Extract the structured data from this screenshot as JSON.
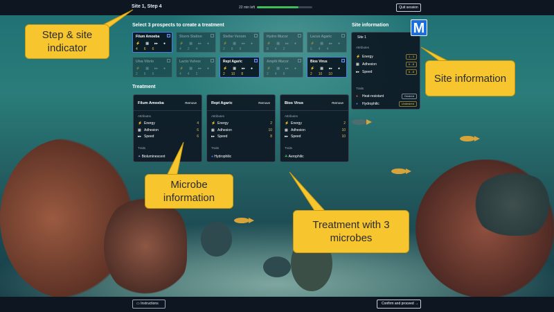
{
  "header": {
    "step": "Site 1, Step 4",
    "time_left": "22 min left",
    "progress": 0.75,
    "quit_label": "Quit session"
  },
  "prospects": {
    "heading": "Select 3 prospects to create a treatment",
    "items": [
      {
        "name": "Filum Amoeba",
        "selected": true,
        "values": [
          "4",
          "6",
          "6"
        ]
      },
      {
        "name": "Storm Station",
        "selected": false,
        "values": [
          "4",
          "2",
          "4"
        ]
      },
      {
        "name": "Stellar Venom",
        "selected": false,
        "values": [
          "2",
          "8",
          "6"
        ]
      },
      {
        "name": "Hydro Mucor",
        "selected": false,
        "values": [
          "8",
          "4",
          "2"
        ]
      },
      {
        "name": "Lacus Agaric",
        "selected": false,
        "values": [
          "6",
          "4",
          "4"
        ]
      },
      {
        "name": "Ulva Vibrio",
        "selected": false,
        "values": [
          "2",
          "6",
          "6"
        ]
      },
      {
        "name": "Lacto Vulvox",
        "selected": false,
        "values": [
          "4",
          "4",
          "2"
        ]
      },
      {
        "name": "Rept Agaric",
        "selected": true,
        "values": [
          "2",
          "10",
          "8"
        ]
      },
      {
        "name": "Amphi Mucor",
        "selected": false,
        "values": [
          "2",
          "4",
          "6"
        ]
      },
      {
        "name": "Bios Virus",
        "selected": true,
        "values": [
          "2",
          "10",
          "10"
        ]
      }
    ]
  },
  "treatment": {
    "heading": "Treatment",
    "attributes_label": "Attributes",
    "traits_label": "Traits",
    "remove_label": "Remove",
    "attr_names": [
      "Energy",
      "Adhesion",
      "Speed"
    ],
    "cards": [
      {
        "name": "Filum Amoeba",
        "values": [
          "4",
          "6",
          "6"
        ],
        "trait": "Bioluminescent"
      },
      {
        "name": "Rept Agaric",
        "values": [
          "2",
          "10",
          "8"
        ],
        "trait": "Hydrophilic"
      },
      {
        "name": "Bios Virus",
        "values": [
          "2",
          "10",
          "10"
        ],
        "trait": "Aerophilic"
      }
    ]
  },
  "site": {
    "heading": "Site information",
    "name": "Site 1",
    "attributes_label": "Attributes",
    "traits_label": "Traits",
    "attributes": [
      {
        "name": "Energy",
        "range": "1 - 3"
      },
      {
        "name": "Adhesion",
        "range": "6 - 8"
      },
      {
        "name": "Speed",
        "range": "6 - 8"
      }
    ],
    "traits": [
      {
        "name": "Heat-resistant",
        "status": "Desired"
      },
      {
        "name": "Hydrophilic",
        "status": "Undesired"
      }
    ]
  },
  "footer": {
    "instructions_label": "Instructions",
    "confirm_label": "Confirm and proceed"
  },
  "logo_letter": "M",
  "callouts": {
    "step": "Step & site indicator",
    "site": "Site information",
    "microbe": "Microbe information",
    "treatment": "Treatment with 3 microbes"
  },
  "colors": {
    "accent": "#4f7ce0",
    "value": "#e9c552",
    "progress": "#3fbf5a",
    "callout": "#f7c62f"
  }
}
